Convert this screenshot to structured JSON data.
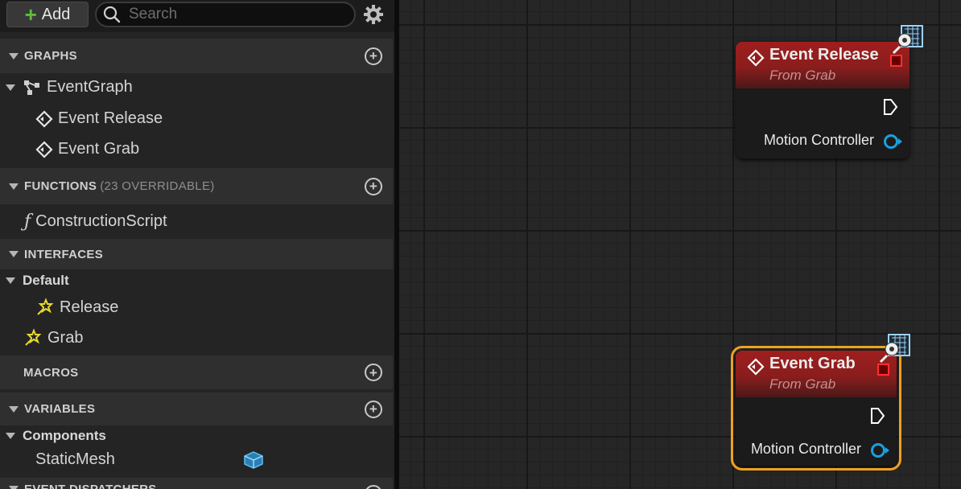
{
  "toolbar": {
    "add_label": "Add",
    "search_placeholder": "Search"
  },
  "sections": {
    "graphs": {
      "label": "GRAPHS"
    },
    "functions": {
      "label": "FUNCTIONS",
      "sub": "(23 OVERRIDABLE)"
    },
    "interfaces": {
      "label": "INTERFACES"
    },
    "macros": {
      "label": "MACROS"
    },
    "variables": {
      "label": "VARIABLES"
    },
    "event_dispatchers": {
      "label": "EVENT DISPATCHERS"
    }
  },
  "graphs": {
    "event_graph": "EventGraph",
    "items": [
      "Event Release",
      "Event Grab"
    ]
  },
  "functions": {
    "items": [
      "ConstructionScript"
    ]
  },
  "interfaces": {
    "category": "Default",
    "category_items": [
      "Release"
    ],
    "items": [
      "Grab"
    ]
  },
  "variables": {
    "category": "Components",
    "items": [
      "StaticMesh"
    ]
  },
  "nodes": [
    {
      "title": "Event Release",
      "subtitle": "From Grab",
      "pin_label": "Motion Controller",
      "selected": false
    },
    {
      "title": "Event Grab",
      "subtitle": "From Grab",
      "pin_label": "Motion Controller",
      "selected": true
    }
  ],
  "colors": {
    "node_header": "#8a1d1d",
    "selection": "#f0a020",
    "object_pin": "#1aa0e0",
    "add_plus": "#5fbb3a"
  }
}
